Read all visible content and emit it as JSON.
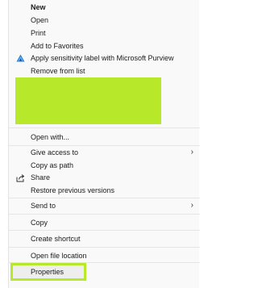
{
  "menu": {
    "items": [
      {
        "label": "New"
      },
      {
        "label": "Open"
      },
      {
        "label": "Print"
      },
      {
        "label": "Add to Favorites"
      },
      {
        "label": "Apply sensitivity label with Microsoft Purview",
        "icon": "purview-sensitivity-icon"
      },
      {
        "label": "Remove from list"
      },
      {
        "label": "Open with..."
      },
      {
        "label": "Give access to",
        "submenu": true
      },
      {
        "label": "Copy as path"
      },
      {
        "label": "Share",
        "icon": "share-icon"
      },
      {
        "label": "Restore previous versions"
      },
      {
        "label": "Send to",
        "submenu": true
      },
      {
        "label": "Copy"
      },
      {
        "label": "Create shortcut"
      },
      {
        "label": "Open file location"
      },
      {
        "label": "Properties"
      }
    ],
    "highlight_color": "#b7e82a"
  }
}
